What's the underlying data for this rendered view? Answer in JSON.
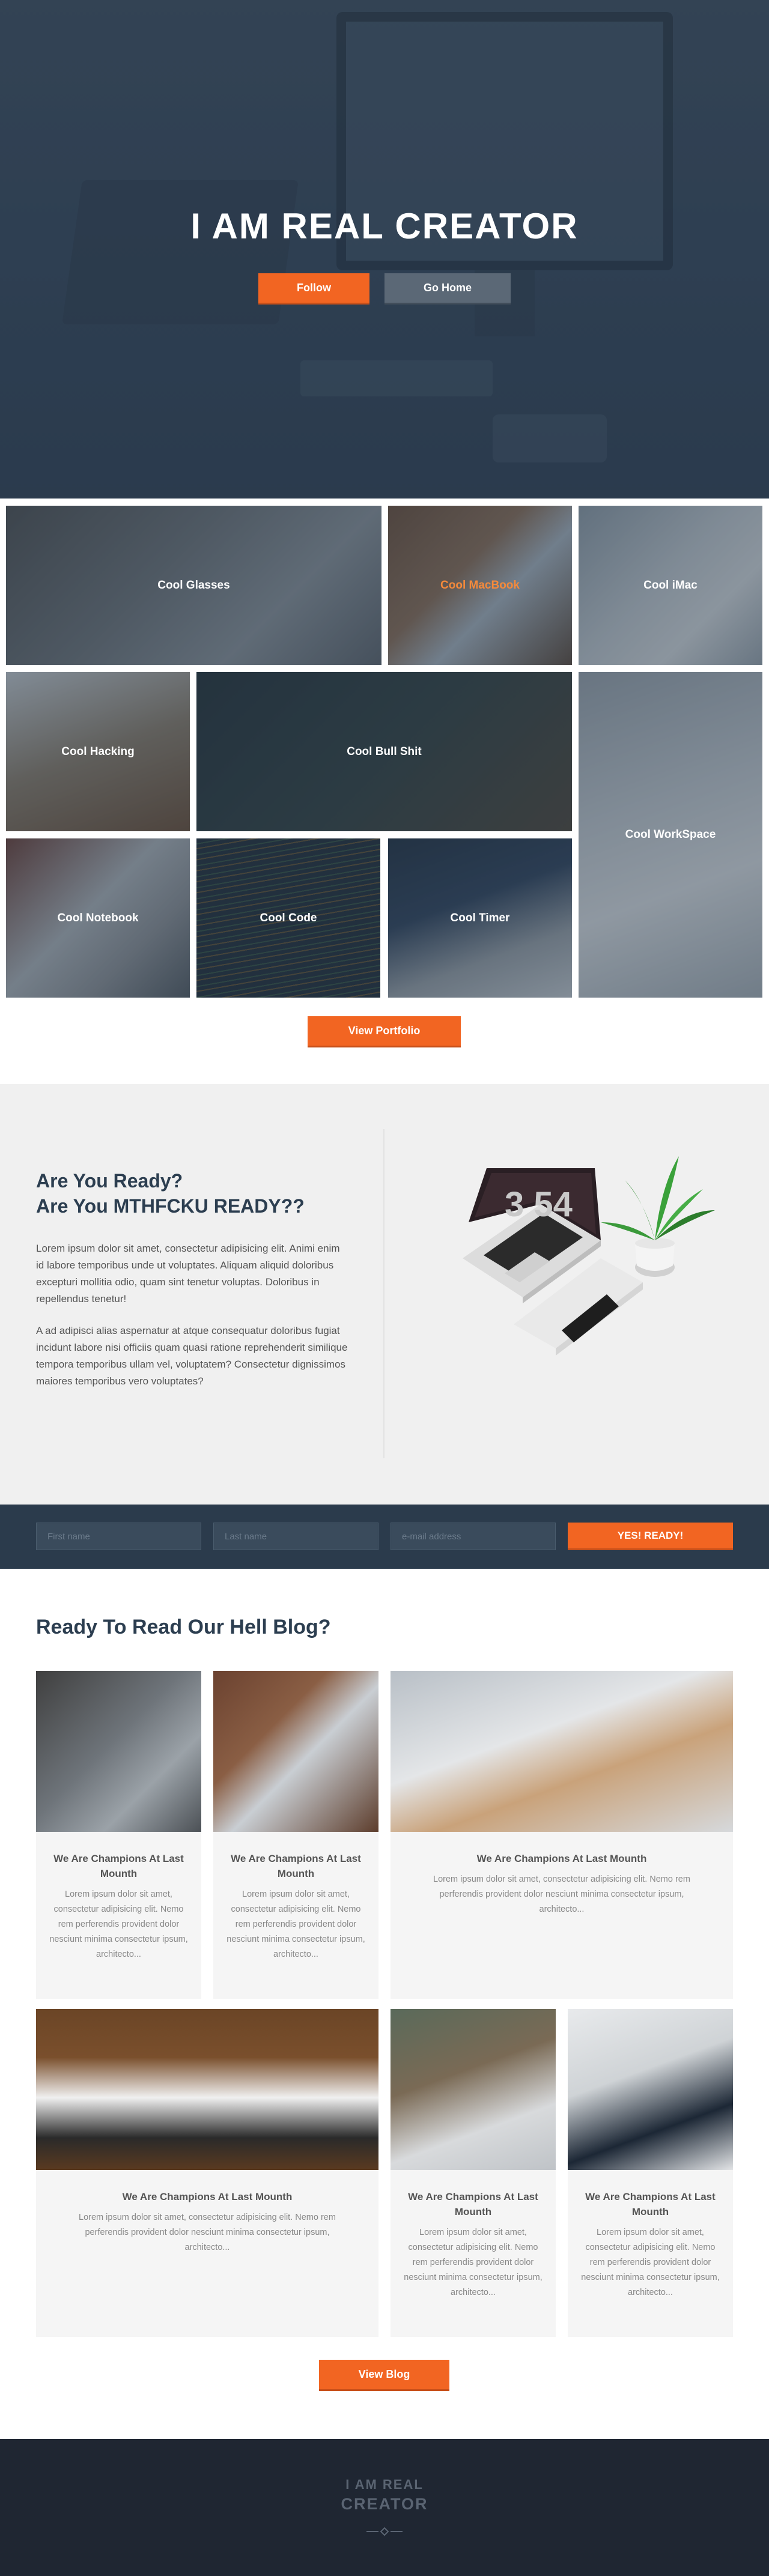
{
  "hero": {
    "title": "I AM REAL CREATOR",
    "follow_label": "Follow",
    "home_label": "Go Home"
  },
  "portfolio": {
    "tiles": [
      {
        "label": "Cool Glasses"
      },
      {
        "label": "Cool MacBook"
      },
      {
        "label": "Cool iMac"
      },
      {
        "label": "Cool Hacking"
      },
      {
        "label": "Cool Bull Shit"
      },
      {
        "label": "Cool WorkSpace"
      },
      {
        "label": "Cool Notebook"
      },
      {
        "label": "Cool Code"
      },
      {
        "label": "Cool Timer"
      }
    ],
    "button_label": "View Portfolio"
  },
  "ready": {
    "title_line1": "Are You Ready?",
    "title_line2": "Are You MTHFCKU READY??",
    "paragraph1": "Lorem ipsum dolor sit amet, consectetur adipisicing elit. Animi enim id labore temporibus unde ut voluptates. Aliquam aliquid doloribus excepturi mollitia odio, quam sint tenetur voluptas. Doloribus in repellendus tenetur!",
    "paragraph2": "A ad adipisci alias aspernatur at atque consequatur doloribus fugiat incidunt labore nisi officiis quam quasi ratione reprehenderit similique tempora temporibus ullam vel, voluptatem? Consectetur dignissimos maiores temporibus vero voluptates?",
    "clock_text": "3 54"
  },
  "form": {
    "first_name_placeholder": "First name",
    "last_name_placeholder": "Last name",
    "email_placeholder": "e-mail address",
    "submit_label": "YES! READY!"
  },
  "blog": {
    "heading": "Ready To Read Our Hell Blog?",
    "cards": [
      {
        "title": "We Are Champions At Last Mounth",
        "text": "Lorem ipsum dolor sit amet, consectetur adipisicing elit. Nemo rem perferendis provident dolor nesciunt minima consectetur ipsum, architecto..."
      },
      {
        "title": "We Are Champions At Last Mounth",
        "text": "Lorem ipsum dolor sit amet, consectetur adipisicing elit. Nemo rem perferendis provident dolor nesciunt minima consectetur ipsum, architecto..."
      },
      {
        "title": "We Are Champions At Last Mounth",
        "text": "Lorem ipsum dolor sit amet, consectetur adipisicing elit. Nemo rem perferendis provident dolor nesciunt minima consectetur ipsum, architecto..."
      },
      {
        "title": "We Are Champions At Last Mounth",
        "text": "Lorem ipsum dolor sit amet, consectetur adipisicing elit. Nemo rem perferendis provident dolor nesciunt minima consectetur ipsum, architecto..."
      },
      {
        "title": "We Are Champions At Last Mounth",
        "text": "Lorem ipsum dolor sit amet, consectetur adipisicing elit. Nemo rem perferendis provident dolor nesciunt minima consectetur ipsum, architecto..."
      },
      {
        "title": "We Are Champions At Last Mounth",
        "text": "Lorem ipsum dolor sit amet, consectetur adipisicing elit. Nemo rem perferendis provident dolor nesciunt minima consectetur ipsum, architecto..."
      }
    ],
    "button_label": "View Blog"
  },
  "footer": {
    "logo_line1": "I AM REAL",
    "logo_line2": "CREATOR",
    "icon": "pen-nib-divider-icon"
  },
  "colors": {
    "accent": "#f26522",
    "dark": "#2c3e50",
    "footer": "#1f2632"
  }
}
